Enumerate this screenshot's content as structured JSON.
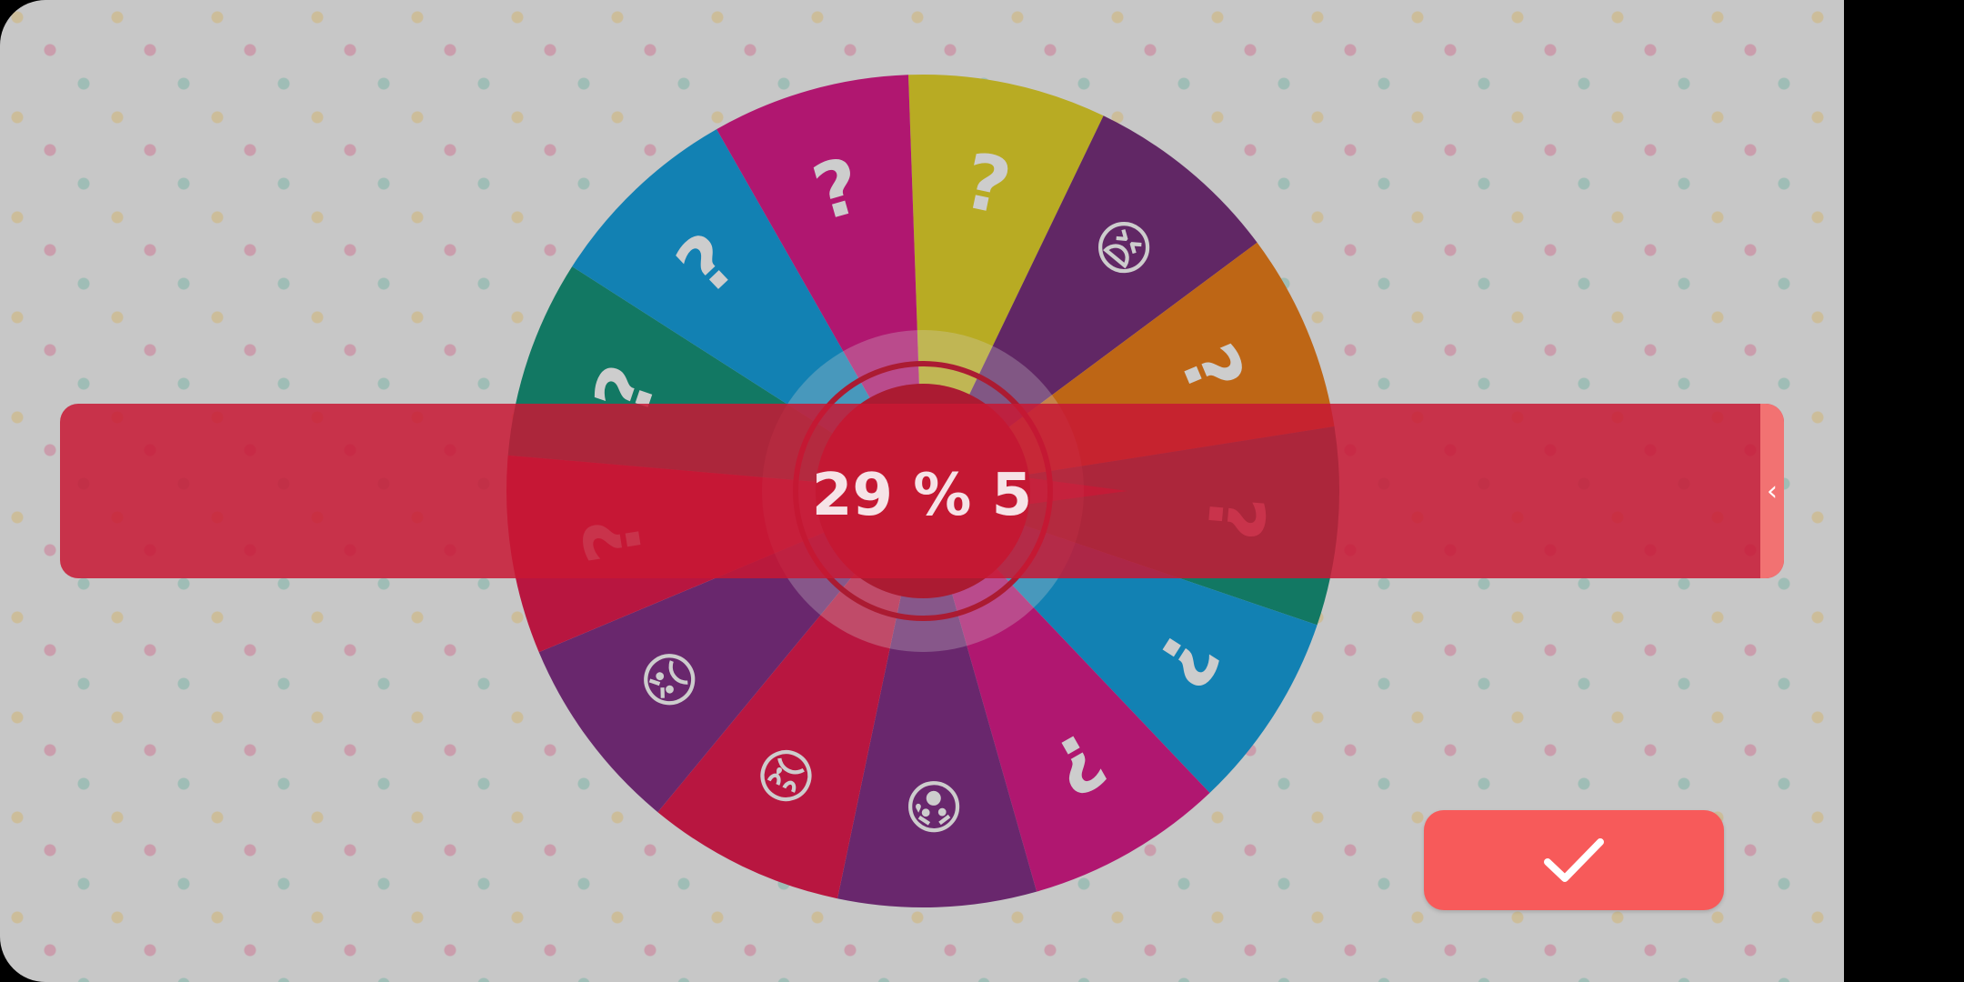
{
  "hub_text": "29 % 5",
  "wheel": {
    "segments": [
      {
        "color": "#d9c81a",
        "symbol": "?"
      },
      {
        "color": "#6a1f6f",
        "symbol": "😫"
      },
      {
        "color": "#e07008",
        "symbol": "?"
      },
      {
        "color": "#04876c",
        "symbol": "?"
      },
      {
        "color": "#0592d2",
        "symbol": "?"
      },
      {
        "color": "#cf0b7d",
        "symbol": "?"
      },
      {
        "color": "#741f79",
        "symbol": "😰"
      },
      {
        "color": "#d9093f",
        "symbol": "😢"
      },
      {
        "color": "#741f79",
        "symbol": "😠"
      },
      {
        "color": "#d9093f",
        "symbol": "?"
      },
      {
        "color": "#04876c",
        "symbol": "?"
      },
      {
        "color": "#0592d2",
        "symbol": "?"
      },
      {
        "color": "#cf0b7d",
        "symbol": "?"
      }
    ]
  },
  "banner": {
    "tab_glyph": "‹"
  },
  "confirm": {
    "icon": "checkmark-icon"
  },
  "colors": {
    "banner": "#c81834",
    "confirm": "#f75a5a",
    "hub": "#c8102e"
  }
}
